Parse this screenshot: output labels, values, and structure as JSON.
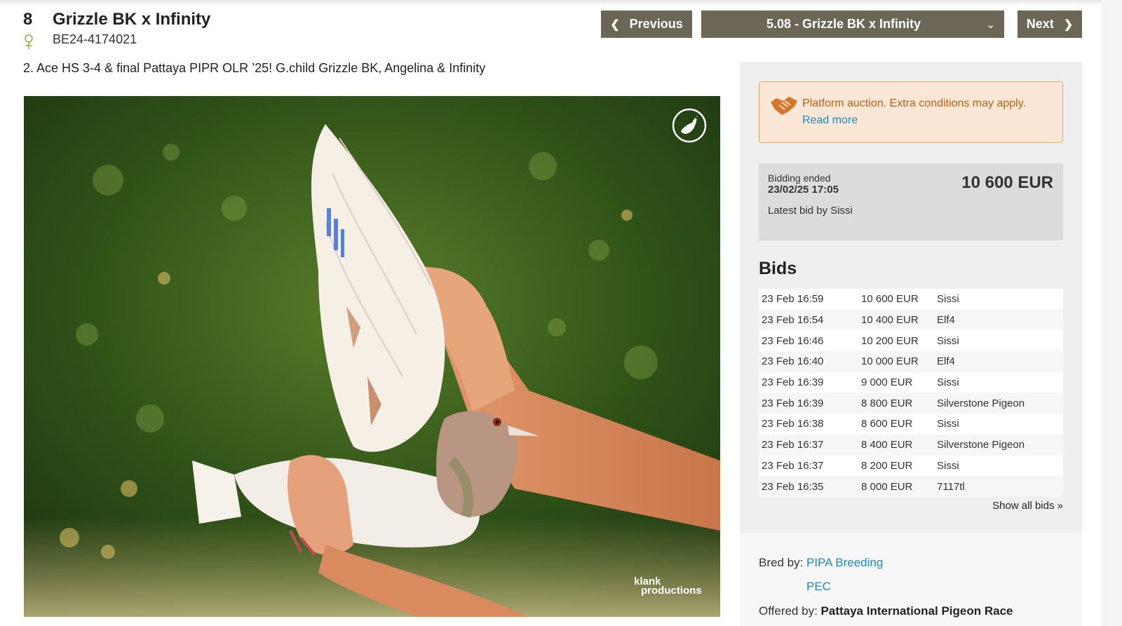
{
  "lot": {
    "number": "8",
    "title": "Grizzle BK x Infinity",
    "ring": "BE24-4174021",
    "description": "2. Ace HS 3-4 & final Pattaya PIPR OLR ’25! G.child Grizzle BK, Angelina & Infinity"
  },
  "nav": {
    "previous_label": "Previous",
    "selected_lot": "5.08 - Grizzle BK x Infinity",
    "next_label": "Next"
  },
  "photo": {
    "credit_line1": "klank",
    "credit_line2": "productions"
  },
  "notice": {
    "text": "Platform auction. Extra conditions may apply.",
    "link": "Read more"
  },
  "status": {
    "label": "Bidding ended",
    "date": "23/02/25 17:05",
    "amount": "10 600 EUR",
    "latest_bid": "Latest bid by Sissi"
  },
  "bids": {
    "title": "Bids",
    "rows": [
      {
        "time": "23 Feb 16:59",
        "amount": "10 600 EUR",
        "bidder": "Sissi"
      },
      {
        "time": "23 Feb 16:54",
        "amount": "10 400 EUR",
        "bidder": "Elf4"
      },
      {
        "time": "23 Feb 16:46",
        "amount": "10 200 EUR",
        "bidder": "Sissi"
      },
      {
        "time": "23 Feb 16:40",
        "amount": "10 000 EUR",
        "bidder": "Elf4"
      },
      {
        "time": "23 Feb 16:39",
        "amount": "9 000 EUR",
        "bidder": "Sissi"
      },
      {
        "time": "23 Feb 16:39",
        "amount": "8 800 EUR",
        "bidder": "Silverstone Pigeon"
      },
      {
        "time": "23 Feb 16:38",
        "amount": "8 600 EUR",
        "bidder": "Sissi"
      },
      {
        "time": "23 Feb 16:37",
        "amount": "8 400 EUR",
        "bidder": "Silverstone Pigeon"
      },
      {
        "time": "23 Feb 16:37",
        "amount": "8 200 EUR",
        "bidder": "Sissi"
      },
      {
        "time": "23 Feb 16:35",
        "amount": "8 000 EUR",
        "bidder": "7117tl"
      }
    ],
    "show_all": "Show all bids »"
  },
  "breeder": {
    "bred_label": "Bred by:",
    "bred_by_1": "PIPA Breeding",
    "bred_by_2": "PEC",
    "offered_label": "Offered by:",
    "offered_by": "Pattaya International Pigeon Race"
  },
  "colors": {
    "nav_button": "#6b6656",
    "link": "#1e88c7",
    "notice_bg": "#fce7d7",
    "notice_text": "#b85f18",
    "sidebar_bg": "#efefef"
  },
  "icons": {
    "prev": "chevron-left-icon",
    "next": "chevron-right-icon",
    "select": "chevron-down-icon",
    "sex": "female-icon",
    "notice": "handshake-icon",
    "watermark": "pigeon-logo-icon"
  }
}
